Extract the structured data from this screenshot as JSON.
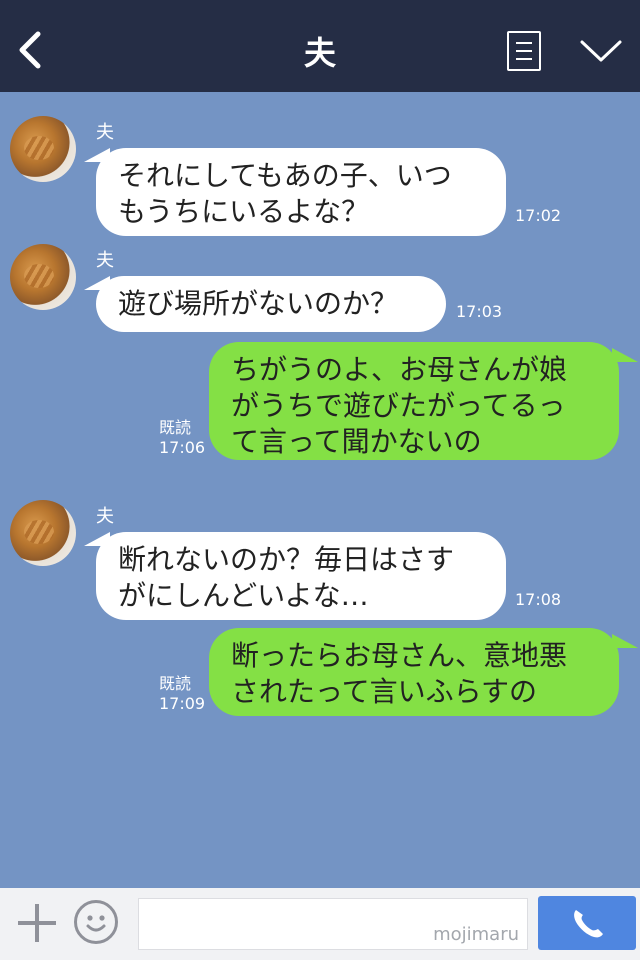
{
  "header": {
    "title": "夫"
  },
  "messages": [
    {
      "sender": "夫",
      "text_line1": "それにしてもあの子、いつ",
      "text_line2": "もうちにいるよな？",
      "time": "17:02"
    },
    {
      "sender": "夫",
      "text_line1": "遊び場所がないのか？",
      "time": "17:03"
    },
    {
      "text_line1": "ちがうのよ、お母さんが娘",
      "text_line2": "がうちで遊びたがってるっ",
      "text_line3": "て言って聞かないの",
      "read": "既読",
      "time": "17:06"
    },
    {
      "sender": "夫",
      "text_line1": "断れないのか？毎日はさす",
      "text_line2": "がにしんどいよな…",
      "time": "17:08"
    },
    {
      "text_line1": "断ったらお母さん、意地悪",
      "text_line2": "されたって言いふらすの",
      "read": "既読",
      "time": "17:09"
    }
  ],
  "footer": {
    "watermark": "mojimaru"
  },
  "icons": {
    "back": "chevron-left-icon",
    "menu": "note-icon",
    "expand": "chevron-down-icon",
    "add": "plus-icon",
    "sticker": "smile-icon",
    "call": "phone-icon"
  },
  "colors": {
    "header": "#252d45",
    "background": "#7494c4",
    "incoming_bubble": "#ffffff",
    "outgoing_bubble": "#84e045",
    "call_button": "#4f86e0"
  }
}
